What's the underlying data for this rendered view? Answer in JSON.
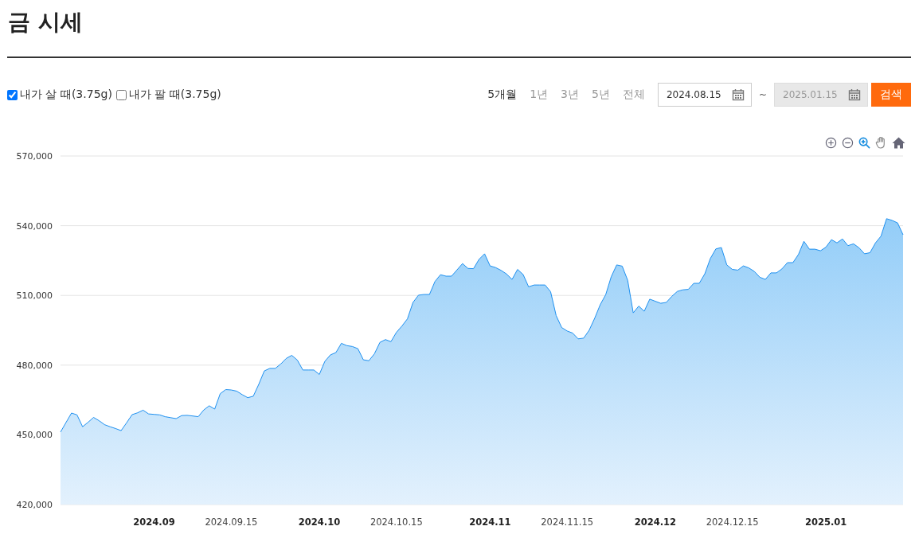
{
  "title": "금 시세",
  "checks": [
    {
      "label": "내가 살 때(3.75g)",
      "checked": true
    },
    {
      "label": "내가 팔 때(3.75g)",
      "checked": false
    }
  ],
  "periods": [
    {
      "label": "5개월",
      "selected": true
    },
    {
      "label": "1년",
      "selected": false
    },
    {
      "label": "3년",
      "selected": false
    },
    {
      "label": "5년",
      "selected": false
    },
    {
      "label": "전체",
      "selected": false
    }
  ],
  "date_range": {
    "start": {
      "value": "2024.08.15",
      "disabled": false
    },
    "separator": "~",
    "end": {
      "value": "2025.01.15",
      "disabled": true
    }
  },
  "search_button": "검색",
  "chart": {
    "chart_data": {
      "type": "area",
      "categories": [
        null,
        null,
        null,
        null,
        null,
        null,
        null,
        null,
        null,
        null,
        null,
        null,
        null,
        null,
        null,
        null,
        null,
        "2024.09",
        null,
        null,
        null,
        null,
        null,
        null,
        null,
        null,
        null,
        null,
        null,
        null,
        null,
        "2024.09.15",
        null,
        null,
        null,
        null,
        null,
        null,
        null,
        null,
        null,
        null,
        null,
        null,
        null,
        null,
        null,
        "2024.10",
        null,
        null,
        null,
        null,
        null,
        null,
        null,
        null,
        null,
        null,
        null,
        null,
        null,
        "2024.10.15",
        null,
        null,
        null,
        null,
        null,
        null,
        null,
        null,
        null,
        null,
        null,
        null,
        null,
        null,
        null,
        null,
        "2024.11",
        null,
        null,
        null,
        null,
        null,
        null,
        null,
        null,
        null,
        null,
        null,
        null,
        null,
        "2024.11.15",
        null,
        null,
        null,
        null,
        null,
        null,
        null,
        null,
        null,
        null,
        null,
        null,
        null,
        null,
        null,
        "2024.12",
        null,
        null,
        null,
        null,
        null,
        null,
        null,
        null,
        null,
        null,
        null,
        null,
        null,
        "2024.12.15",
        null,
        null,
        null,
        null,
        null,
        null,
        null,
        null,
        null,
        null,
        null,
        null,
        null,
        null,
        null,
        null,
        "2025.01",
        null,
        null,
        null,
        null,
        null,
        null,
        null,
        null,
        null,
        null,
        null,
        null,
        null,
        null
      ],
      "values": [
        451200,
        455300,
        459400,
        458600,
        453500,
        455400,
        457500,
        456100,
        454400,
        453500,
        452700,
        451800,
        455200,
        458700,
        459500,
        460600,
        459000,
        458800,
        458600,
        457800,
        457400,
        457000,
        458300,
        458400,
        458100,
        457800,
        460700,
        462500,
        461100,
        467700,
        469500,
        469300,
        468800,
        467300,
        466000,
        466600,
        471700,
        477500,
        478600,
        478600,
        480500,
        482900,
        484200,
        482200,
        477900,
        477900,
        477900,
        476000,
        481600,
        484400,
        485400,
        489400,
        488400,
        488000,
        487100,
        482300,
        481900,
        484900,
        489800,
        491000,
        490100,
        494100,
        496800,
        499900,
        507000,
        510100,
        510400,
        510400,
        516000,
        518900,
        518300,
        518300,
        521000,
        523700,
        521600,
        521500,
        525500,
        527900,
        522700,
        522000,
        520800,
        519200,
        516900,
        521200,
        519000,
        513700,
        514500,
        514500,
        514500,
        511600,
        501300,
        496200,
        494700,
        493800,
        491300,
        491600,
        495000,
        500200,
        506000,
        510300,
        518000,
        523100,
        522600,
        516500,
        502500,
        505400,
        503200,
        508400,
        507500,
        506600,
        507000,
        509600,
        511700,
        512400,
        512600,
        515200,
        515200,
        519300,
        525900,
        530000,
        530600,
        523100,
        521200,
        520900,
        522700,
        521800,
        520300,
        517800,
        516900,
        519700,
        519700,
        521400,
        524100,
        524100,
        527600,
        533300,
        529900,
        529900,
        529200,
        530800,
        534000,
        532600,
        534300,
        531400,
        532200,
        530500,
        527900,
        528400,
        532600,
        535500,
        543000,
        542300,
        541200,
        536100
      ],
      "ylim": [
        420000,
        570000
      ],
      "grid": true,
      "yticks": [
        {
          "value": 420000,
          "label": "420,000"
        },
        {
          "value": 450000,
          "label": "450,000"
        },
        {
          "value": 480000,
          "label": "480,000"
        },
        {
          "value": 510000,
          "label": "510,000"
        },
        {
          "value": 540000,
          "label": "540,000"
        },
        {
          "value": 570000,
          "label": "570,000"
        }
      ]
    }
  }
}
